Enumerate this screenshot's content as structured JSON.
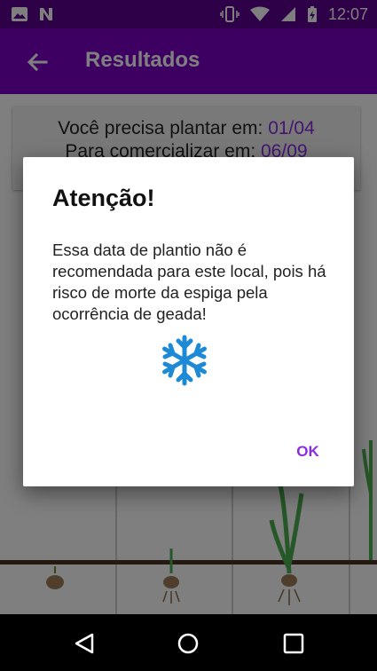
{
  "status_bar": {
    "time": "12:07",
    "left_icons": [
      "image-icon",
      "n-notification-icon"
    ],
    "right_icons": [
      "vibrate-icon",
      "wifi-icon",
      "signal-icon",
      "battery-charging-icon"
    ]
  },
  "app_bar": {
    "title": "Resultados",
    "back_icon": "arrow-left-icon"
  },
  "info_card": {
    "plant_prefix": "Você precisa plantar em:",
    "plant_date": "01/04",
    "sell_prefix": "Para comercializar em:",
    "sell_date": "06/09"
  },
  "dialog": {
    "title": "Atenção!",
    "message": "Essa data de plantio não é recomendada para este local, pois há risco de morte da espiga pela ocorrência de geada!",
    "icon": "snowflake-icon",
    "ok_label": "OK"
  },
  "nav_bar": {
    "buttons": [
      "back-triangle-icon",
      "home-circle-icon",
      "recents-square-icon"
    ]
  },
  "colors": {
    "status_bar": "#5c0091",
    "app_bar": "#7b00c4",
    "accent": "#8a2be2",
    "snowflake": "#1e8ad6"
  }
}
